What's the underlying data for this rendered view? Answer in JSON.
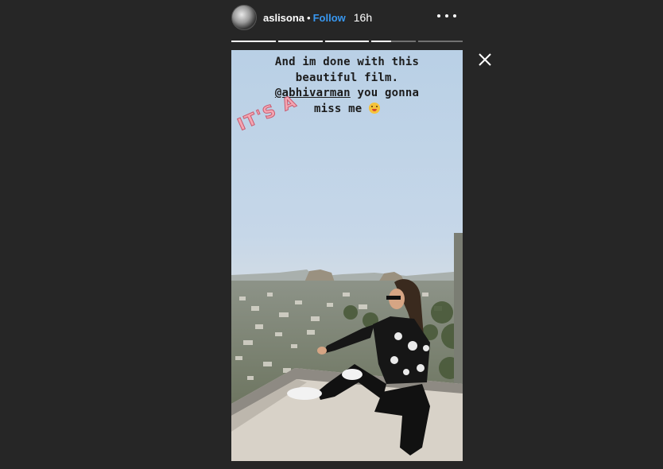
{
  "header": {
    "username": "aslisona",
    "separator": "•",
    "follow_label": "Follow",
    "time": "16h"
  },
  "icons": {
    "avatar": "avatar-icon",
    "more": "more-options-icon",
    "close": "close-icon"
  },
  "progress": [
    1.0,
    1.0,
    1.0,
    0.45,
    0.0
  ],
  "story": {
    "caption_line1": "And im done with this",
    "caption_line2": "beautiful film.",
    "mention": "@abhivarman",
    "caption_line3_rest": " you gonna",
    "caption_line4": "miss me",
    "sticker_text": "IT'S A"
  },
  "colors": {
    "background": "#262626",
    "follow": "#3897f0",
    "sticker": "#f4a6b2"
  }
}
